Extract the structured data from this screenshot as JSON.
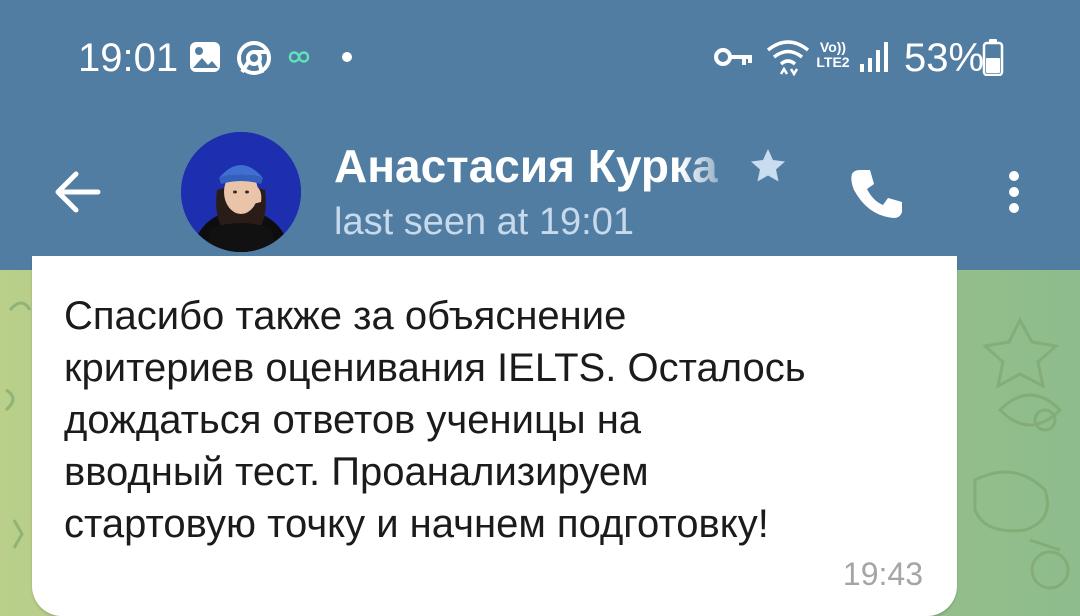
{
  "status_bar": {
    "time": "19:01",
    "battery_percent": "53%",
    "network_label_top": "Vo))",
    "network_label_bottom": "LTE2",
    "left_icons": [
      "gallery-icon",
      "chrome-icon",
      "infinity-icon",
      "dot-icon"
    ],
    "right_icons": [
      "key-icon",
      "wifi-icon",
      "signal-icon",
      "battery-icon"
    ]
  },
  "chat_header": {
    "contact_name": "Анастасия Курка",
    "status": "last seen at 19:01",
    "back_icon": "arrow-left-icon",
    "favorite_icon": "star-icon",
    "call_icon": "phone-icon",
    "menu_icon": "more-vertical-icon"
  },
  "message": {
    "text": "Спасибо также за объяснение\nкритериев оценивания IELTS. Осталось\nдождаться ответов ученицы на\nвводный тест. Проанализируем\nстартовую точку и начнем подготовку!",
    "time": "19:43"
  },
  "colors": {
    "header_bg": "#527da3",
    "bubble_bg": "#ffffff",
    "status_text": "#c7daec",
    "time_text": "#a5a5a5",
    "wallpaper": "#a8c787"
  }
}
